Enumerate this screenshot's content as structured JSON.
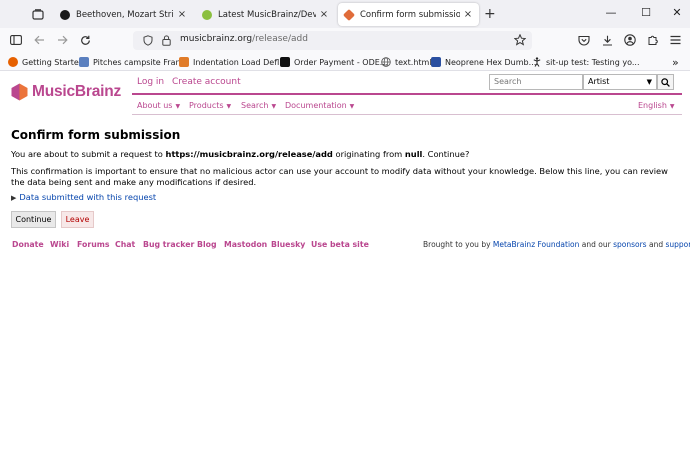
{
  "browser": {
    "tabs": [
      {
        "label": "Beethoven, Mozart String Trio -",
        "active": false,
        "favicon_color": "#1a1a1a"
      },
      {
        "label": "Latest MusicBrainz/Developmen",
        "active": false,
        "favicon_color": "#8bbf3f"
      },
      {
        "label": "Confirm form submission - Mus",
        "active": true,
        "favicon_color": "#e06c3a"
      }
    ],
    "tab_close_glyph": "×",
    "new_tab_glyph": "+",
    "window_controls": {
      "minimize": "—",
      "maximize": "☐",
      "close": "✕"
    },
    "url": {
      "host": "musicbrainz.org",
      "path": "/release/add"
    },
    "bookmarks": [
      {
        "label": "Getting Started",
        "icon_color": "#e66000"
      },
      {
        "label": "Pitches campsite Fran...",
        "icon_color": "#5a7fbf"
      },
      {
        "label": "Indentation Load Defl...",
        "icon_color": "#e07b28"
      },
      {
        "label": "Order Payment - ODE...",
        "icon_color": "#111111"
      },
      {
        "label": "text.html",
        "icon_color": "#555555"
      },
      {
        "label": "Neoprene Hex Dumb...",
        "icon_color": "#2a4fa0"
      },
      {
        "label": "sit-up test: Testing yo...",
        "icon_color": "#222222"
      }
    ],
    "bookmarks_overflow": "»"
  },
  "site": {
    "logo_text": "MusicBrainz",
    "login": "Log in",
    "create_account": "Create account",
    "search": {
      "placeholder": "Search",
      "type": "Artist"
    },
    "menu": {
      "about": "About us",
      "products": "Products",
      "search": "Search",
      "documentation": "Documentation",
      "language": "English"
    },
    "colors": {
      "brand": "#ba478f",
      "link": "#0645ad",
      "leave": "#b30000"
    }
  },
  "main": {
    "title": "Confirm form submission",
    "intro": {
      "before": "You are about to submit a request to ",
      "url": "https://musicbrainz.org/release/add",
      "middle": " originating from ",
      "origin": "null",
      "after": ". Continue?"
    },
    "explanation": "This confirmation is important to ensure that no malicious actor can use your account to modify data without your knowledge. Below this line, you can review the data being sent and make any modifications if desired.",
    "details_summary": "Data submitted with this request",
    "continue_label": "Continue",
    "leave_label": "Leave"
  },
  "footer": {
    "links": [
      "Donate",
      "Wiki",
      "Forums",
      "Chat",
      "Bug tracker",
      "Blog",
      "Mastodon",
      "Bluesky",
      "Use beta site"
    ],
    "credit": {
      "prefix": "Brought to you by ",
      "org": "MetaBrainz Foundation",
      "mid": " and our ",
      "sponsors": "sponsors",
      "and": " and ",
      "supporters": "supporters",
      "end": "."
    }
  }
}
